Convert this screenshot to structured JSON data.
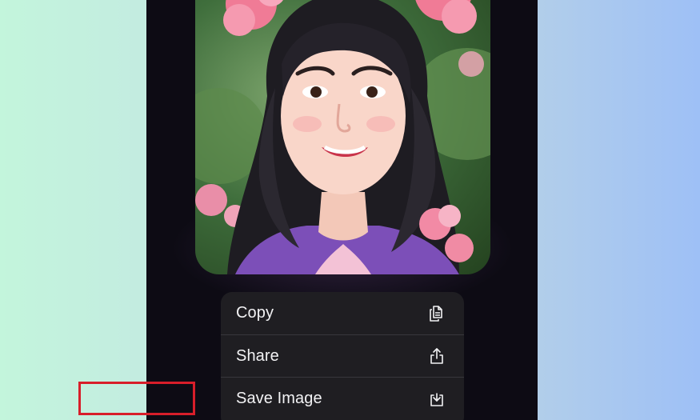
{
  "context_menu": {
    "items": [
      {
        "label": "Copy",
        "icon": "copy-icon"
      },
      {
        "label": "Share",
        "icon": "share-icon"
      },
      {
        "label": "Save Image",
        "icon": "save-image-icon"
      }
    ]
  },
  "highlight": {
    "target": "Save Image",
    "color": "#d81e2a"
  },
  "colors": {
    "background_left": "#c3f5dc",
    "background_right": "#9ec0f6",
    "phone_background": "#0d0b14",
    "menu_background": "#1f1e22",
    "menu_text": "#f2f2f4"
  }
}
